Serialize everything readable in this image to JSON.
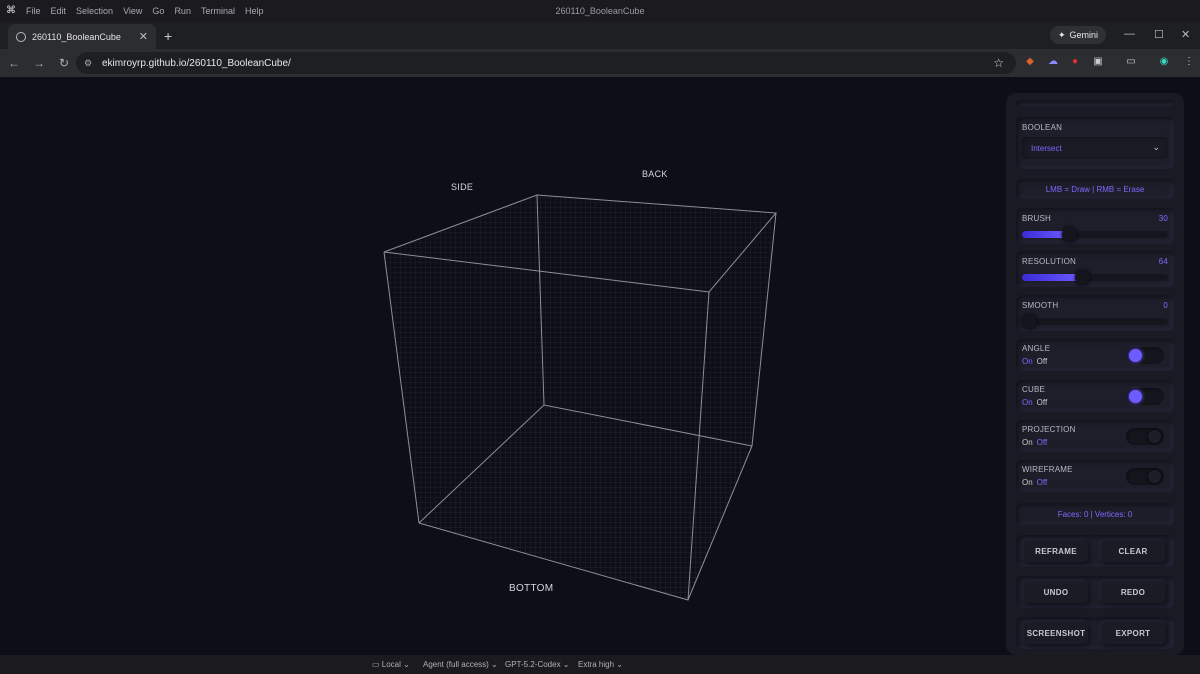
{
  "os_menu": {
    "items": [
      "File",
      "Edit",
      "Selection",
      "View",
      "Go",
      "Run",
      "Terminal",
      "Help"
    ],
    "window_title": "260110_BooleanCube"
  },
  "browser": {
    "tab_title": "260110_BooleanCube",
    "gemini_label": "Gemini",
    "url": "ekimroyrp.github.io/260110_BooleanCube/"
  },
  "viewport": {
    "labels": {
      "side": "SIDE",
      "back": "BACK",
      "bottom": "BOTTOM"
    }
  },
  "panel": {
    "boolean": {
      "label": "BOOLEAN",
      "value": "Intersect"
    },
    "hint": "LMB = Draw | RMB = Erase",
    "brush": {
      "label": "BRUSH",
      "value": "30",
      "fill": 0.32
    },
    "resolution": {
      "label": "RESOLUTION",
      "value": "64",
      "fill": 0.41
    },
    "smooth": {
      "label": "SMOOTH",
      "value": "0",
      "fill": 0.0
    },
    "angle": {
      "label": "ANGLE",
      "on": "On",
      "off": "Off",
      "state": "on"
    },
    "cube": {
      "label": "CUBE",
      "on": "On",
      "off": "Off",
      "state": "on"
    },
    "projection": {
      "label": "PROJECTION",
      "on": "On",
      "off": "Off",
      "state": "off"
    },
    "wireframe": {
      "label": "WIREFRAME",
      "on": "On",
      "off": "Off",
      "state": "off"
    },
    "stats": "Faces: 0 | Vertices: 0",
    "buttons": {
      "reframe": "REFRAME",
      "clear": "CLEAR",
      "undo": "UNDO",
      "redo": "REDO",
      "screenshot": "SCREENSHOT",
      "export": "EXPORT"
    }
  },
  "statusbar": {
    "local": "Local",
    "agent": "Agent (full access)",
    "model": "GPT-5.2-Codex",
    "effort": "Extra high"
  },
  "colors": {
    "accent": "#6d5cff",
    "panel_bg": "#1a1a24",
    "viewport_bg": "#0e0e16"
  }
}
